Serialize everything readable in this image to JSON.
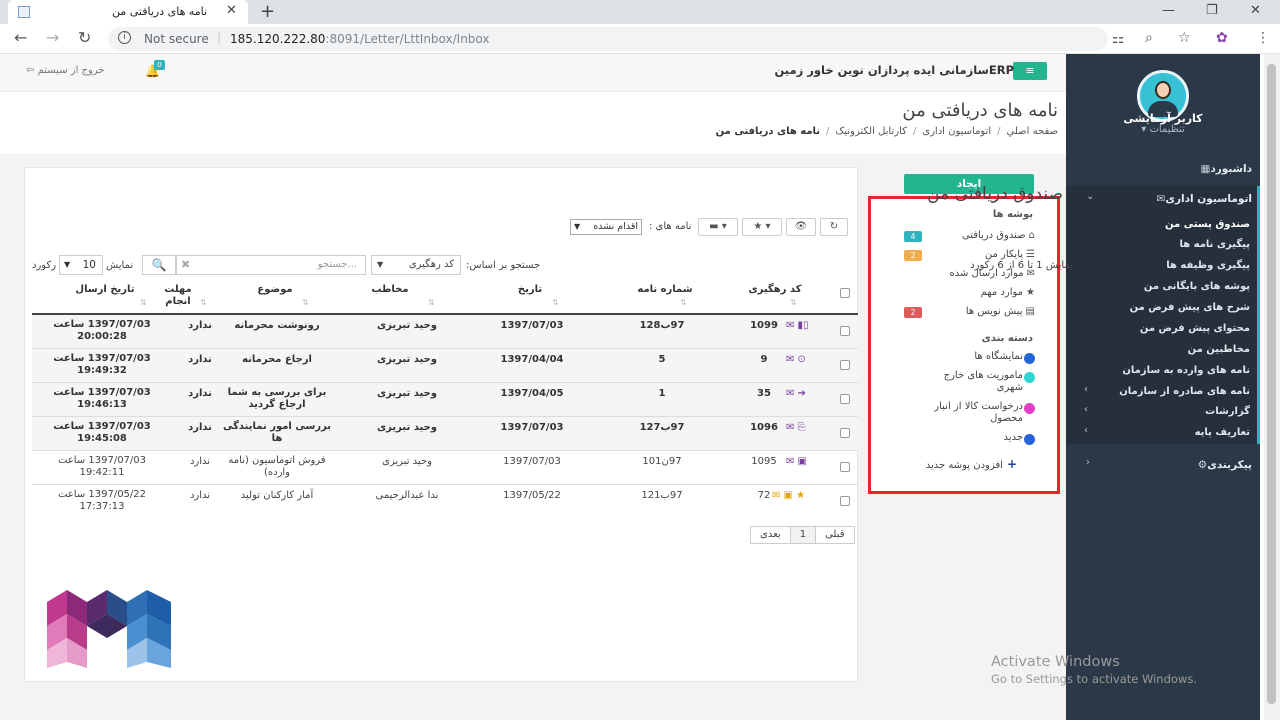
{
  "browser": {
    "tab_title": "نامه های دریافتی من",
    "close_glyph": "✕",
    "new_tab_glyph": "+",
    "not_secure": "Not secure",
    "url_host": "185.120.222.80",
    "url_rest": ":8091/Letter/LttInbox/Inbox",
    "back_glyph": "←",
    "forward_glyph": "→",
    "reload_glyph": "↻",
    "info_glyph": "i",
    "translate_glyph": "⚏",
    "zoom_glyph": "⌕",
    "star_glyph": "☆",
    "extension_glyph": "✿",
    "menu_glyph": "⋮",
    "minimize_glyph": "—",
    "restore_glyph": "❐",
    "close_window_glyph": "✕"
  },
  "header": {
    "org_name": "ERPسازمانی ایده پردازان نوین خاور زمین",
    "menu_glyph": "≡",
    "logout": "خروج از سیستم",
    "logout_icon": "⇦",
    "bell_glyph": "🔔",
    "notif_count": "0"
  },
  "page": {
    "title": "نامه های دریافتی من",
    "breadcrumb": [
      "صفحه اصلي",
      "اتوماسیون اداری",
      "کارتابل الکترونیک",
      "نامه های دریافتی من"
    ],
    "breadcrumb_sep": "/"
  },
  "sidebar": {
    "user_name": "کاربر آزمایشی",
    "user_settings": "تنظیمات ▾",
    "dashboard": "داشبورد",
    "dashboard_icon": "▦",
    "automation": "اتوماسیون اداری",
    "automation_icon": "✉",
    "expanded_chevron": "⌄",
    "collapsed_chevron": "‹",
    "settings_chevron": "›",
    "items": [
      "صندوق پستی من",
      "پیگیری نامه ها",
      "پیگیری وظیفه ها",
      "پوشه های بایگانی من",
      "شرح های پیش فرض من",
      "محتوای پیش فرض من",
      "مخاطبین من",
      "نامه های وارده به سازمان",
      "نامه های صادره از سازمان",
      "گزارشات",
      "تعاریف پایه"
    ],
    "config": "پیکربندی",
    "config_icon": "⚙"
  },
  "folders": {
    "create_button": "ایجاد",
    "header": "پوشه ها",
    "items": [
      {
        "label": "صندوق دریافتی",
        "icon": "⌂",
        "badge": "4",
        "color": "#2fb3c1"
      },
      {
        "label": "پایکار من",
        "icon": "☰",
        "badge": "2",
        "color": "#f0ad4e"
      },
      {
        "label": "موارد ارسال شده",
        "icon": "✉",
        "badge": "",
        "color": ""
      },
      {
        "label": "موارد مهم",
        "icon": "★",
        "badge": "",
        "color": ""
      },
      {
        "label": "پیش نویس ها",
        "icon": "▤",
        "badge": "2",
        "color": "#e05a5a"
      }
    ],
    "categories_header": "دسته بندی",
    "categories": [
      {
        "label": "نمایشگاه ها",
        "color": "#2563d9"
      },
      {
        "label": "ماموریت های خارج شهری",
        "color": "#2fd6d0"
      },
      {
        "label": "درخواست کالا از انبار محصول",
        "color": "#e040c8"
      },
      {
        "label": "جدید",
        "color": "#2563d9"
      }
    ],
    "add_folder_icon": "+",
    "add_folder": "افزودن پوشه جدید"
  },
  "inbox": {
    "title": "صندوق دریافتی من",
    "toolbar": {
      "refresh_icon": "↻",
      "view_icon": "👁",
      "star_icon": "★ ▾",
      "folder_icon": "▬ ▾",
      "letters_label": "نامه های :",
      "letters_filter": "اقدام نشده",
      "dropdown_arrow": "▼"
    },
    "showing": "نمایش 1 تا 6 از 6 رکورد",
    "search_by_label": "جستجو بر اساس:",
    "search_by_value": "کد رهگیری",
    "search_placeholder": "جستجو...",
    "search_clear_icon": "✖",
    "search_icon": "🔍",
    "show_label": "نمایش",
    "page_size": "10",
    "record_label": "رکورد",
    "sort_icon": "⇅",
    "columns": {
      "tracking": "کد رهگیری",
      "number": "شماره نامه",
      "date": "تاریخ",
      "contact": "مخاطب",
      "subject": "موضوع",
      "deadline": "مهلت انجام",
      "sent": "تاریخ ارسال"
    },
    "rows": [
      {
        "tracking": "1099",
        "icons": "✉ ▮▯",
        "number": "97ب128",
        "date": "1397/07/03",
        "contact": "وحید تبریزی",
        "subject": "رونوشت محرمانه",
        "deadline": "ندارد",
        "sent": "1397/07/03 ساعت 20:00:28",
        "unread": true
      },
      {
        "tracking": "9",
        "icons": "✉ ⊙",
        "number": "5",
        "date": "1397/04/04",
        "contact": "وحید تبریزی",
        "subject": "ارجاع محرمانه",
        "deadline": "ندارد",
        "sent": "1397/07/03 ساعت 19:49:32",
        "unread": true
      },
      {
        "tracking": "35",
        "icons": "✉ ➔",
        "number": "1",
        "date": "1397/04/05",
        "contact": "وحید تبریزی",
        "subject": "برای بررسی به شما ارجاع گردید",
        "deadline": "ندارد",
        "sent": "1397/07/03 ساعت 19:46:13",
        "unread": true
      },
      {
        "tracking": "1096",
        "icons": "✉ ⎘",
        "number": "97ب127",
        "date": "1397/07/03",
        "contact": "وحید تبریزی",
        "subject": "بررسی امور نمایندگی ها",
        "deadline": "ندارد",
        "sent": "1397/07/03 ساعت 19:45:08",
        "unread": true
      },
      {
        "tracking": "1095",
        "icons": "✉ ▣",
        "number": "97ن101",
        "date": "1397/07/03",
        "contact": "وحید تبریزی",
        "subject": "فروش اتوماسیون (نامه وارده)",
        "deadline": "ندارد",
        "sent": "1397/07/03 ساعت 19:42:11",
        "unread": false
      },
      {
        "tracking": "72",
        "icons": "✉ ▣ ★",
        "number": "97ب121",
        "date": "1397/05/22",
        "contact": "ندا عبدالرحیمی",
        "subject": "آمار کارکنان تولید",
        "deadline": "ندارد",
        "sent": "1397/05/22 ساعت 17:37:13",
        "unread": false
      }
    ],
    "pager": {
      "prev": "قبلی",
      "page": "1",
      "next": "بعدی"
    }
  },
  "watermark": {
    "line1": "Activate Windows",
    "line2": "Go to Settings to activate Windows."
  }
}
